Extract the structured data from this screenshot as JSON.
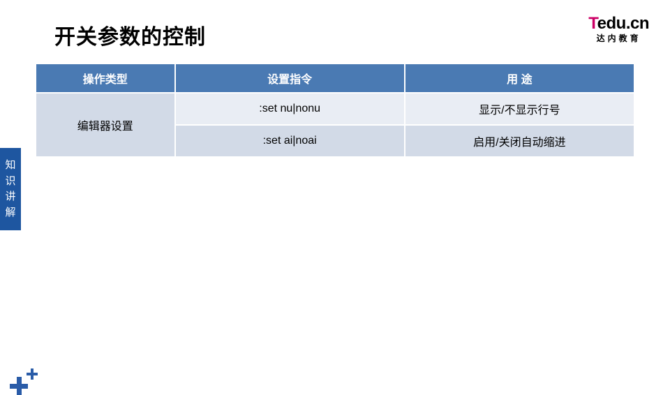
{
  "title": "开关参数的控制",
  "logo": {
    "t": "T",
    "rest": "edu.cn",
    "sub": "达内教育"
  },
  "sideTab": {
    "c1": "知",
    "c2": "识",
    "c3": "讲",
    "c4": "解"
  },
  "table": {
    "headers": [
      "操作类型",
      "设置指令",
      "用 途"
    ],
    "rowspan_label": "编辑器设置",
    "rows": [
      {
        "cmd": ":set nu|nonu",
        "desc": "显示/不显示行号"
      },
      {
        "cmd": ":set ai|noai",
        "desc": "启用/关闭自动缩进"
      }
    ]
  }
}
